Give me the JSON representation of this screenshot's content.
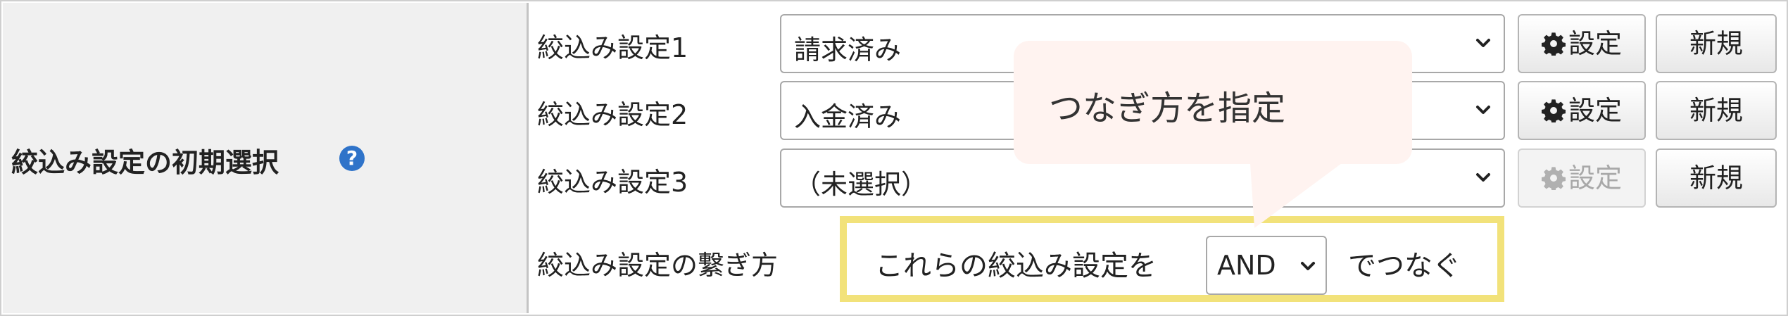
{
  "setting": {
    "label": "絞込み設定の初期選択",
    "help_icon_glyph": "?"
  },
  "rows": [
    {
      "label": "絞込み設定1",
      "selected": "請求済み",
      "settings_label": "設定",
      "new_label": "新規",
      "settings_enabled": true
    },
    {
      "label": "絞込み設定2",
      "selected": "入金済み",
      "settings_label": "設定",
      "new_label": "新規",
      "settings_enabled": true
    },
    {
      "label": "絞込み設定3",
      "selected": "（未選択）",
      "settings_label": "設定",
      "new_label": "新規",
      "settings_enabled": false
    }
  ],
  "connector": {
    "label": "絞込み設定の繋ぎ方",
    "prefix": "これらの絞込み設定を",
    "operator": "AND",
    "suffix": "でつなぐ"
  },
  "callout": {
    "text": "つなぎ方を指定"
  },
  "colors": {
    "label_bg": "#f0f0f0",
    "highlight_border": "#f2e27a",
    "callout_bg": "#fff3f0",
    "help_icon": "#2f73c9"
  },
  "icons": [
    "help-icon",
    "gear-icon",
    "chevron-down-icon"
  ]
}
